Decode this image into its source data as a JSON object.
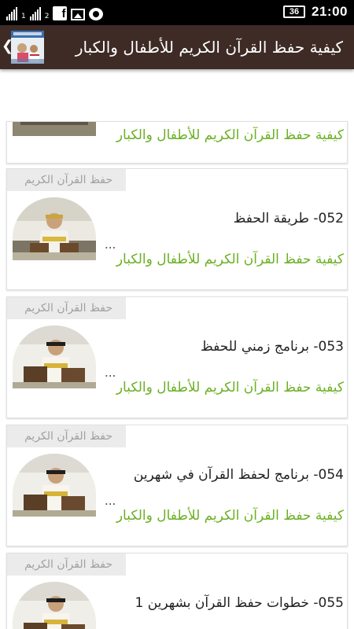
{
  "status_bar": {
    "sim1": "1",
    "sim2": "2",
    "battery": "36",
    "time": "21:00",
    "icons": [
      "signal-icon",
      "signal-icon",
      "facebook-icon",
      "image-icon",
      "chat-icon"
    ]
  },
  "app_bar": {
    "title": "كيفية حفظ القرآن الكريم للأطفال والكبار",
    "back_glyph": "❮"
  },
  "items": [
    {
      "tag": "",
      "title": "",
      "ellipsis": "",
      "subtitle": "كيفية حفظ القرآن الكريم للأطفال والكبار"
    },
    {
      "tag": "حفظ القرآن الكريم",
      "title": "052- طريقة الحفظ",
      "ellipsis": "...",
      "subtitle": "كيفية حفظ القرآن الكريم للأطفال والكبار"
    },
    {
      "tag": "حفظ القرآن الكريم",
      "title": "053- برنامج زمني للحفظ",
      "ellipsis": "...",
      "subtitle": "كيفية حفظ القرآن الكريم للأطفال والكبار"
    },
    {
      "tag": "حفظ القرآن الكريم",
      "title": "054- برنامج لحفظ القرآن في شهرين",
      "ellipsis": "...",
      "subtitle": "كيفية حفظ القرآن الكريم للأطفال والكبار"
    },
    {
      "tag": "حفظ القرآن الكريم",
      "title": "055- خطوات حفظ القرآن بشهرين 1",
      "ellipsis": "...",
      "subtitle": ""
    }
  ],
  "colors": {
    "app_bar": "#3e2b25",
    "subtitle_green": "#6ab023",
    "tag_bg": "#ebebeb",
    "tag_text": "#a0a0a0"
  }
}
